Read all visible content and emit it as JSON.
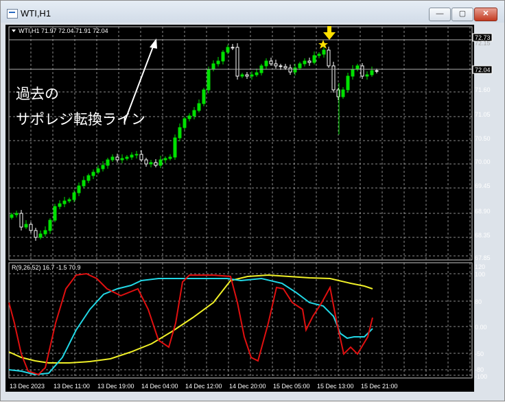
{
  "window": {
    "title": "WTI,H1",
    "minimize_label": "—",
    "maximize_label": "▢",
    "close_label": "✕"
  },
  "chart": {
    "symbol_info": "WTI,H1  71.97 72.04 71.91 72.04",
    "price_ticks": [
      "72.73",
      "72.04",
      "71.60",
      "71.05",
      "70.50",
      "70.00",
      "69.45",
      "68.90",
      "68.35",
      "67.85"
    ],
    "extra_tick": "72.15",
    "annotation_line1": "過去の",
    "annotation_line2": "サポレジ転換ライン"
  },
  "oscillator": {
    "label": "R(9,26,52) 16.7 -1.5 70.9",
    "ticks": [
      "120",
      "100",
      "80",
      "0.00",
      "-50",
      "-80",
      "-100"
    ],
    "colors": {
      "fast": "#e01010",
      "mid": "#22d8e6",
      "slow": "#f0f028"
    }
  },
  "x_axis": {
    "labels": [
      "13 Dec 2023",
      "13 Dec 11:00",
      "13 Dec 19:00",
      "14 Dec 04:00",
      "14 Dec 12:00",
      "14 Dec 20:00",
      "15 Dec 05:00",
      "15 Dec 13:00",
      "15 Dec 21:00"
    ]
  },
  "colors": {
    "bull": "#00e000",
    "bear": "#ffffff",
    "grid": "#c8c8c8",
    "marker": "#ffe000"
  }
}
